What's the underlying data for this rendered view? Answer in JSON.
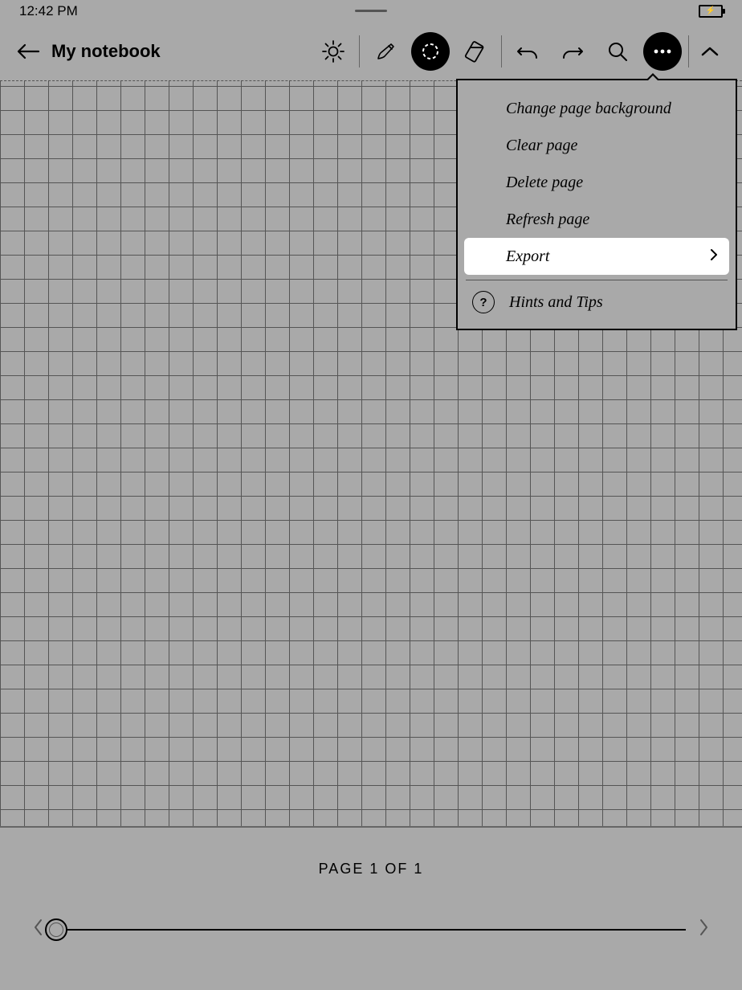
{
  "status": {
    "time": "12:42 PM"
  },
  "header": {
    "title": "My notebook"
  },
  "menu": {
    "items": [
      {
        "label": "Change page background"
      },
      {
        "label": "Clear page"
      },
      {
        "label": "Delete page"
      },
      {
        "label": "Refresh page"
      },
      {
        "label": "Export",
        "selected": true,
        "has_submenu": true
      }
    ],
    "help_label": "Hints and Tips"
  },
  "footer": {
    "page_label": "PAGE 1 OF 1"
  }
}
